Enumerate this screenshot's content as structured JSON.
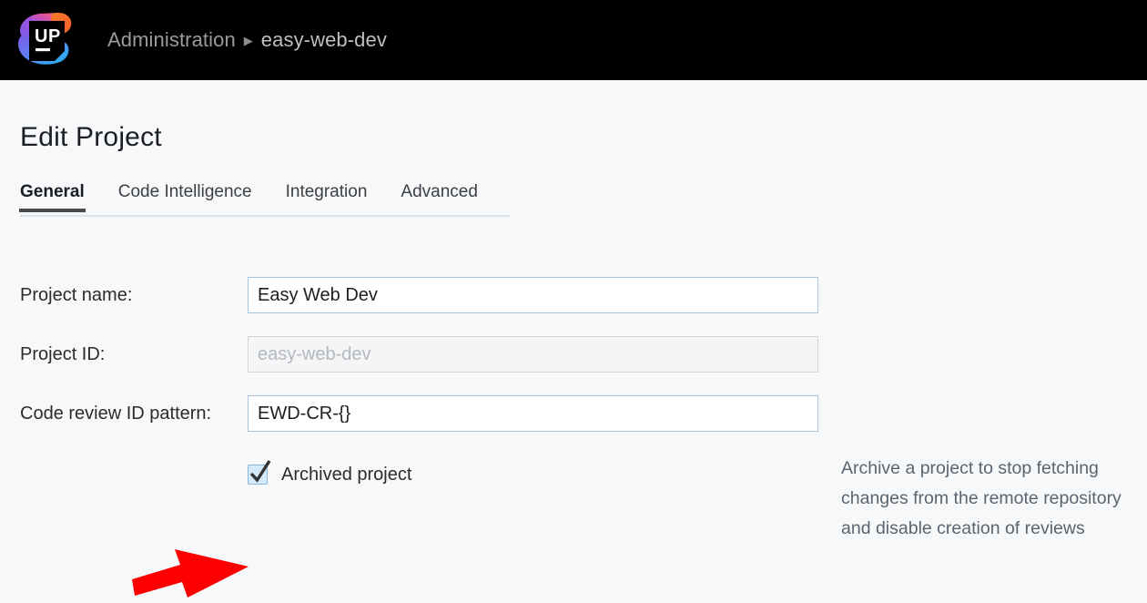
{
  "header": {
    "logo_name": "upsource-logo",
    "logo_text": "UP",
    "breadcrumb": {
      "root_label": "Administration",
      "separator": "▶",
      "current_label": "easy-web-dev"
    }
  },
  "main": {
    "page_title": "Edit Project",
    "tabs": [
      {
        "label": "General",
        "active": true
      },
      {
        "label": "Code Intelligence",
        "active": false
      },
      {
        "label": "Integration",
        "active": false
      },
      {
        "label": "Advanced",
        "active": false
      }
    ],
    "fields": [
      {
        "label": "Project name:",
        "value": "Easy Web Dev",
        "placeholder": "",
        "disabled": false
      },
      {
        "label": "Project ID:",
        "value": "",
        "placeholder": "easy-web-dev",
        "disabled": true
      },
      {
        "label": "Code review ID pattern:",
        "value": "EWD-CR-{}",
        "placeholder": "",
        "disabled": false
      }
    ],
    "archived_checkbox": {
      "label": "Archived project",
      "checked": true
    },
    "help_text": "Archive a project to stop fetching changes from the remote repository and disable creation of reviews"
  },
  "annotation": {
    "arrow_name": "red-arrow-annotation",
    "arrow_color": "#fc0000",
    "points_to": "Archived project"
  },
  "colors": {
    "header_bg": "#000000",
    "page_bg": "#f7f8fa",
    "input_border": "#a7c5e0",
    "checkbox_fill": "#d4eafb",
    "tab_underline": "#4a4a4a"
  }
}
